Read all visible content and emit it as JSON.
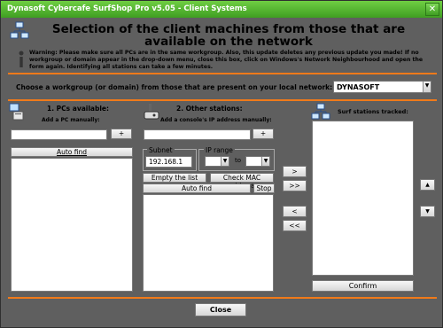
{
  "window": {
    "title": "Dynasoft Cybercafe SurfShop Pro v5.05 - Client Systems",
    "close_glyph": "✕"
  },
  "heading": "Selection of the client machines from those that are available on the network",
  "warning": "Warning: Please make sure all PCs are in the same workgroup. Also, this update deletes any previous update you made! If no workgroup or domain appear in the drop-down menu, close this box, click on Windows's Network Neighbourhood and open the form again. Identifying all stations can take a few minutes.",
  "workgroup": {
    "label": "Choose a workgroup (or domain) from those that are present on your local network:",
    "value": "DYNASOFT"
  },
  "pcs": {
    "title": "1. PCs available:",
    "add_label": "Add a PC manually:",
    "plus": "+",
    "auto_find": "Auto find"
  },
  "other": {
    "title": "2. Other stations:",
    "add_label": "Add a console's IP address manually:",
    "plus": "+",
    "subnet_label": "Subnet",
    "subnet_value": "192.168.1",
    "ip_range_label": "IP range",
    "to_label": "to",
    "empty_list": "Empty the list",
    "check_mac": "Check MAC address",
    "auto_find": "Auto find",
    "stop": "Stop"
  },
  "transfer": {
    "add": ">",
    "add_all": ">>",
    "remove": "<",
    "remove_all": "<<"
  },
  "tracked": {
    "title": "Surf stations tracked:",
    "confirm": "Confirm"
  },
  "order": {
    "up": "▲",
    "down": "▼"
  },
  "footer": {
    "close": "Close"
  },
  "colors": {
    "titlebar": "#4ea82c",
    "background": "#5f5f5f",
    "separator": "#f07a1a"
  }
}
